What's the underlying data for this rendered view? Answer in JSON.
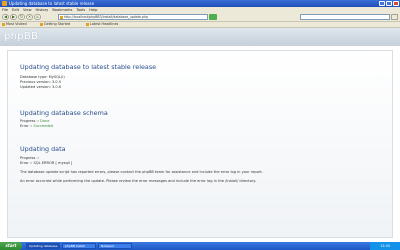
{
  "window": {
    "title": "Updating database to latest stable release"
  },
  "menu": {
    "items": [
      "File",
      "Edit",
      "View",
      "History",
      "Bookmarks",
      "Tools",
      "Help"
    ]
  },
  "address_bar": {
    "url": "http://localhost/phpBB3/install/database_update.php"
  },
  "bookmarks": {
    "items": [
      "Most Visited",
      "Getting Started",
      "Latest Headlines"
    ]
  },
  "page": {
    "logo": "phpBB",
    "sections": [
      {
        "heading": "Updating database to latest stable release",
        "lines": [
          "Database type: MySQL(i)",
          "Previous version: 3.0.5",
          "Updated version: 3.0.6"
        ]
      },
      {
        "heading": "Updating database schema",
        "lines": [
          {
            "label": "Progress :: ",
            "value": "Done"
          },
          {
            "label": "Error :: ",
            "value": "Succeeded"
          }
        ]
      },
      {
        "heading": "Updating data",
        "lines": [
          "Progress ::",
          "Error :: SQL ERROR [ mysqli ]",
          "The database update script has reported errors, please contact the phpBB team for assistance and include the error log in your report.",
          "An error occurred while performing the update. Please review the error messages and include the error log in the /install/ directory."
        ]
      }
    ]
  },
  "taskbar": {
    "start_label": "start",
    "items": [
      "Updating database",
      "phpBB install",
      "Notepad"
    ],
    "clock": "12:00"
  }
}
